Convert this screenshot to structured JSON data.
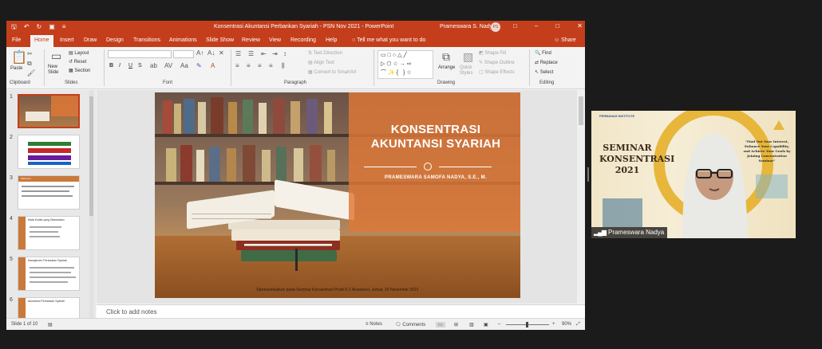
{
  "window": {
    "title": "Konsentrasi Akuntansi Perbankan Syariah - PSN Nov 2021  -  PowerPoint",
    "user": "Prameswara S. Nadya",
    "avatar_initials": "PS",
    "accent": "#c43e1c"
  },
  "tabs": [
    "File",
    "Home",
    "Insert",
    "Draw",
    "Design",
    "Transitions",
    "Animations",
    "Slide Show",
    "Review",
    "View",
    "Recording",
    "Help"
  ],
  "active_tab": "Home",
  "tell_me": "Tell me what you want to do",
  "share": "Share",
  "ribbon": {
    "clipboard": {
      "label": "Clipboard",
      "paste": "Paste"
    },
    "slides": {
      "label": "Slides",
      "new_slide": "New Slide",
      "layout": "Layout",
      "reset": "Reset",
      "section": "Section"
    },
    "font": {
      "label": "Font",
      "bold": "B",
      "italic": "I",
      "underline": "U",
      "strike": "S"
    },
    "paragraph": {
      "label": "Paragraph",
      "text_direction": "Text Direction",
      "align_text": "Align Text",
      "smartart": "Convert to SmartArt"
    },
    "drawing": {
      "label": "Drawing",
      "arrange": "Arrange",
      "quick_styles": "Quick Styles",
      "shape_fill": "Shape Fill",
      "shape_outline": "Shape Outline",
      "shape_effects": "Shape Effects"
    },
    "editing": {
      "label": "Editing",
      "find": "Find",
      "replace": "Replace",
      "select": "Select"
    }
  },
  "thumbnails": [
    {
      "num": "1",
      "title": ""
    },
    {
      "num": "2",
      "title": ""
    },
    {
      "num": "3",
      "title": "Welcome..."
    },
    {
      "num": "4",
      "title": "Mata Kuliah yang Ditawarkan"
    },
    {
      "num": "5",
      "title": "Manajemen Perbankan Syariah"
    },
    {
      "num": "6",
      "title": "Akuntansi Perbankan Syariah"
    }
  ],
  "slide": {
    "title": "KONSENTRASI AKUNTANSI SYARIAH",
    "presenter": "PRAMESWARA SAMOFA NADYA, S.E., M.",
    "caption": "Dipresentasikan pada Seminar Konsentrasi Prodi S-1 Akuntansi, Jumat, 26 November 2021",
    "overlay_color": "#de7837"
  },
  "notes_placeholder": "Click to add notes",
  "status": {
    "slide_info": "Slide 1 of 10",
    "notes": "Notes",
    "comments": "Comments",
    "zoom": "90%"
  },
  "video": {
    "brand": "PERBANAS INSTITUTE",
    "seminar": "SEMINAR KONSENTRASI 2021",
    "quote": "\"Find Out Your Interest, Enhance Your Capability, and Achieve Your Goals by Joining Concentration Seminar\"",
    "participant": "Prameswara Nadya"
  }
}
